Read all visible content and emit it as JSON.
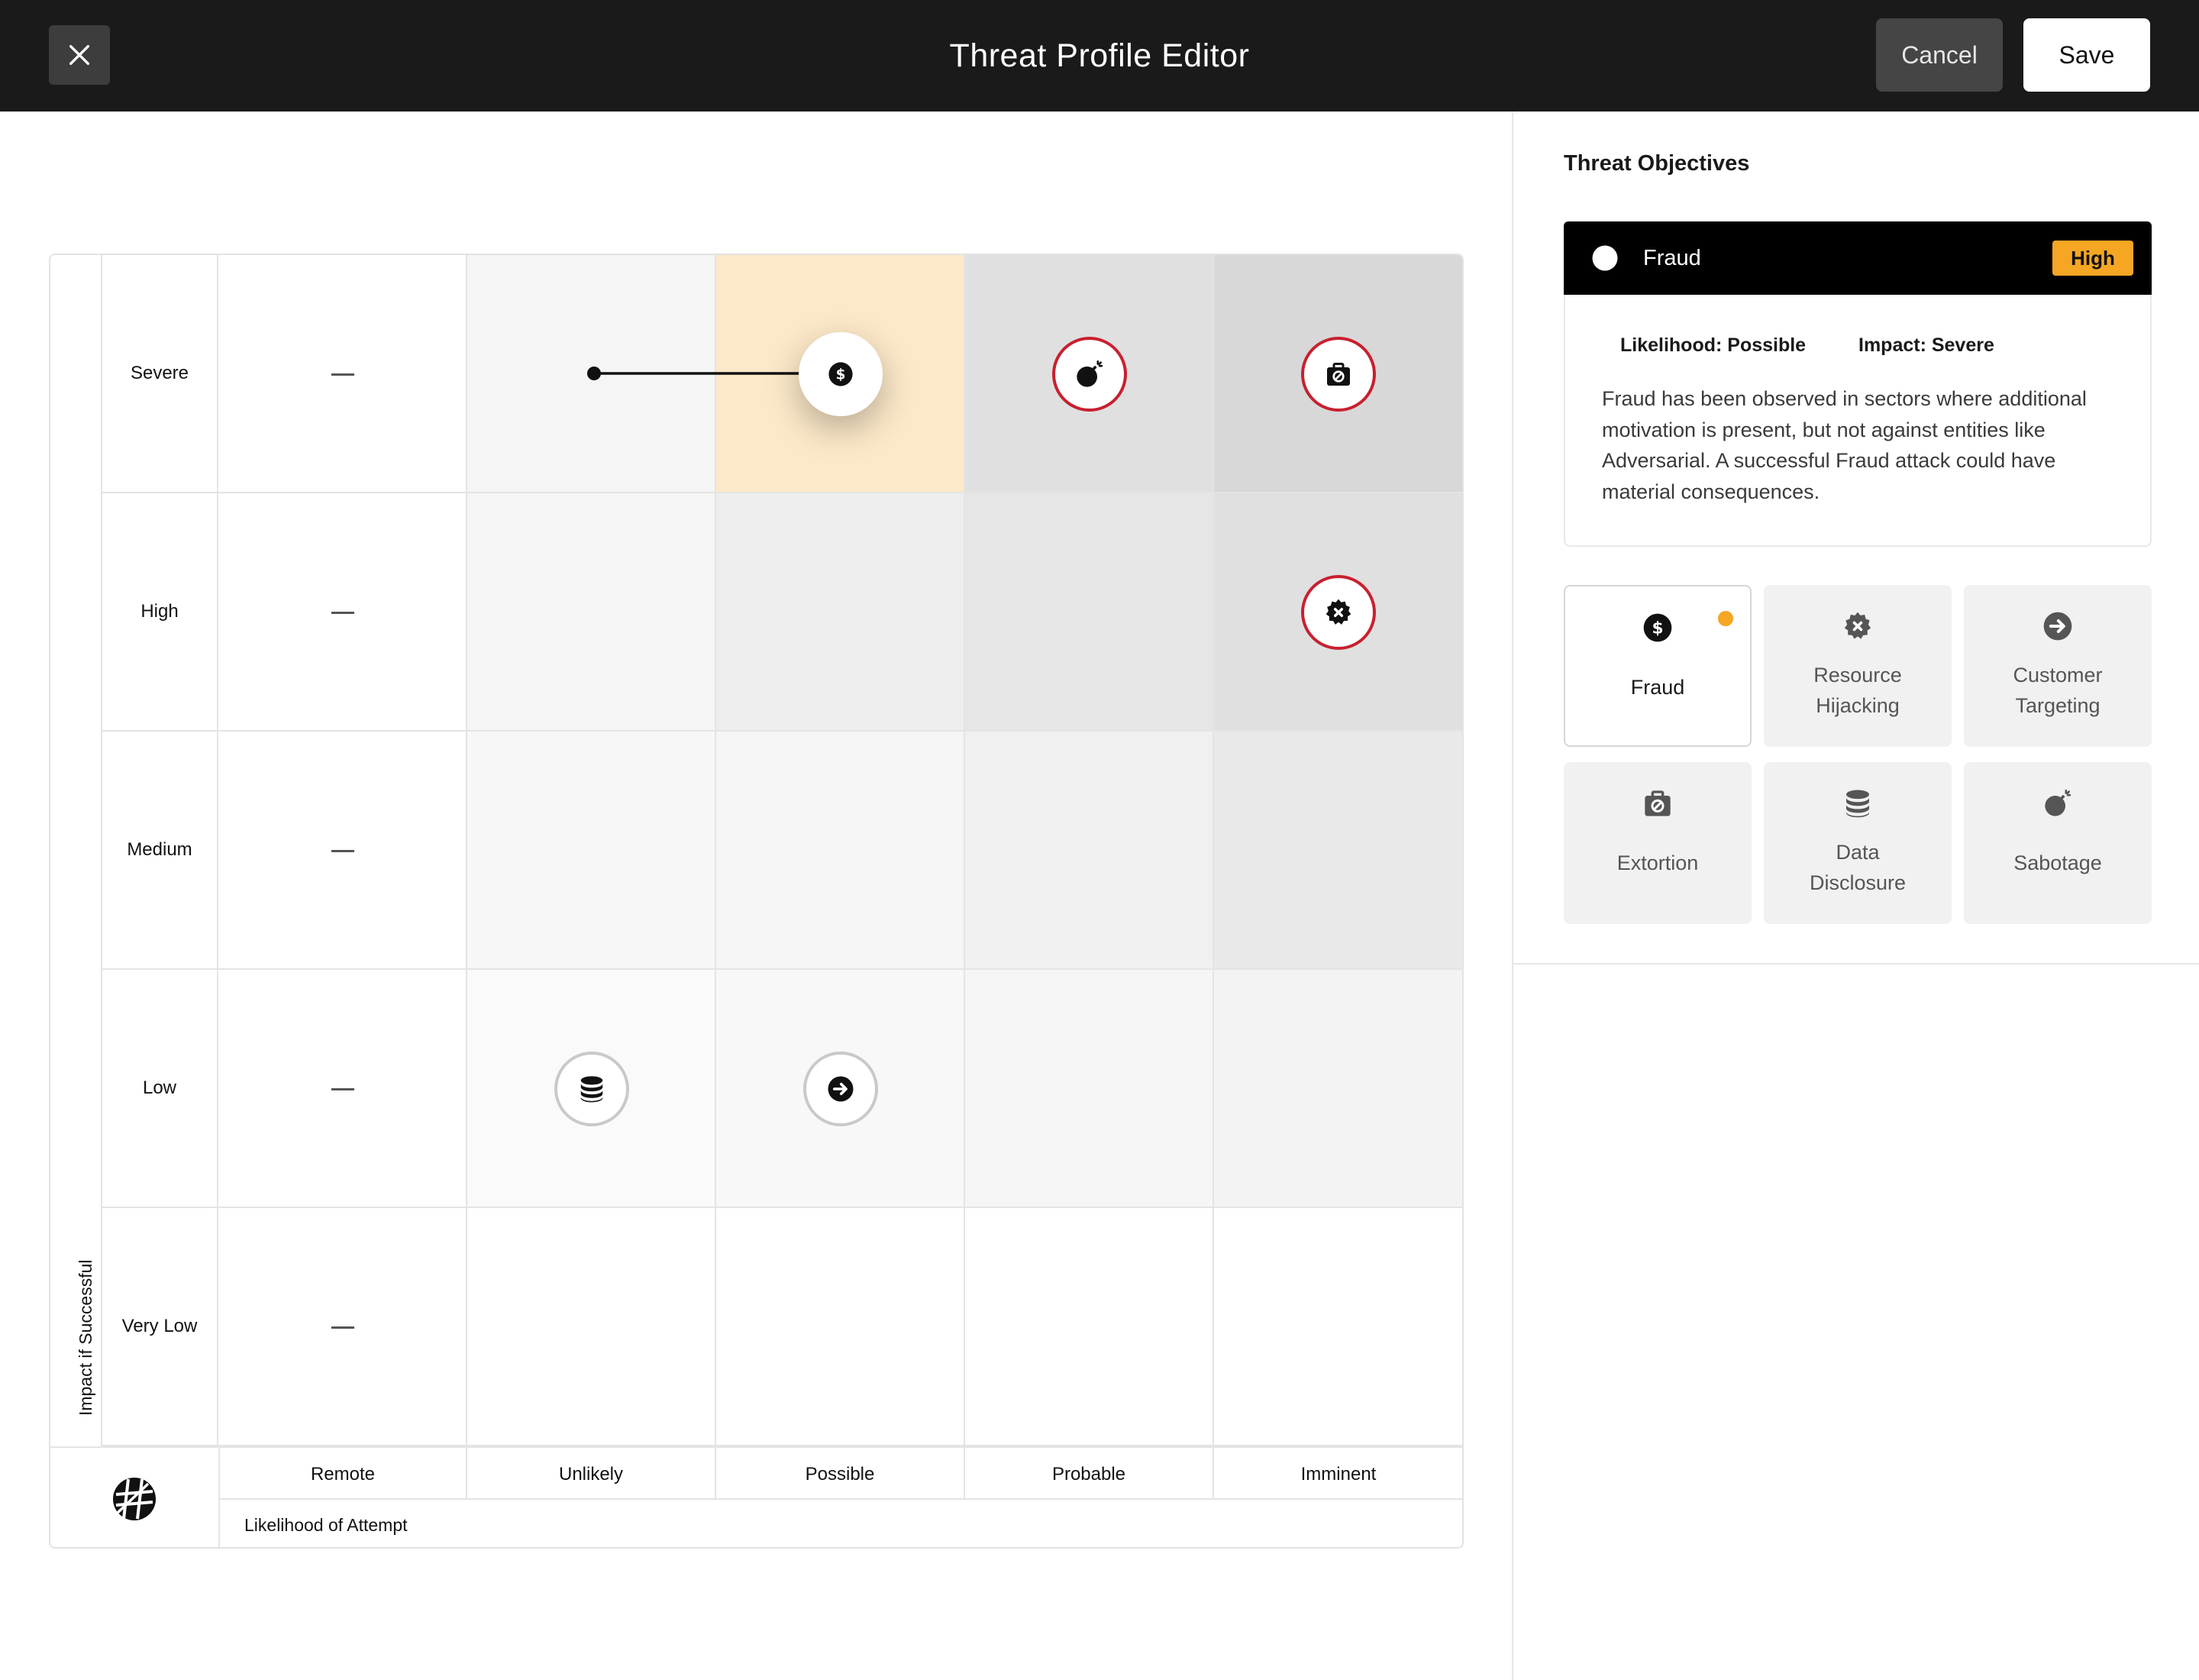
{
  "header": {
    "title": "Threat Profile Editor",
    "cancel_label": "Cancel",
    "save_label": "Save"
  },
  "matrix": {
    "y_axis_label": "Impact if Successful",
    "x_axis_label": "Likelihood of Attempt",
    "rows": [
      "Severe",
      "High",
      "Medium",
      "Low",
      "Very Low"
    ],
    "columns": [
      "Remote",
      "Unlikely",
      "Possible",
      "Probable",
      "Imminent"
    ],
    "remote_placeholder": "—",
    "colors": {
      "highlight_cell": "#fde9c9",
      "risk_border": "#c8202f",
      "neutral_border": "#c9c9c9"
    },
    "placements": [
      {
        "objective": "Fraud",
        "impact": "Severe",
        "likelihood": "Possible",
        "icon": "dollar-icon",
        "style": "selected",
        "moved_from": "Unlikely"
      },
      {
        "objective": "Sabotage",
        "impact": "Severe",
        "likelihood": "Probable",
        "icon": "bomb-icon",
        "style": "red"
      },
      {
        "objective": "Extortion",
        "impact": "Severe",
        "likelihood": "Imminent",
        "icon": "briefcase-icon",
        "style": "red"
      },
      {
        "objective": "Resource Hijacking",
        "impact": "High",
        "likelihood": "Imminent",
        "icon": "gear-x-icon",
        "style": "red"
      },
      {
        "objective": "Data Disclosure",
        "impact": "Low",
        "likelihood": "Unlikely",
        "icon": "database-icon",
        "style": "grey"
      },
      {
        "objective": "Customer Targeting",
        "impact": "Low",
        "likelihood": "Possible",
        "icon": "arrow-right-icon",
        "style": "grey"
      }
    ]
  },
  "panel": {
    "title": "Threat Objectives",
    "selected": {
      "name": "Fraud",
      "icon": "dollar-icon",
      "badge": "High",
      "badge_color": "#f5a623",
      "likelihood": "Likelihood: Possible",
      "impact": "Impact: Severe",
      "description": "Fraud has been observed in sectors where additional motivation is present, but not against entities like Adversarial. A successful Fraud attack could have material consequences."
    },
    "objectives": [
      {
        "label": "Fraud",
        "icon": "dollar-icon",
        "active": true
      },
      {
        "label": "Resource Hijacking",
        "icon": "gear-x-icon",
        "active": false
      },
      {
        "label": "Customer Targeting",
        "icon": "arrow-right-icon",
        "active": false
      },
      {
        "label": "Extortion",
        "icon": "briefcase-icon",
        "active": false
      },
      {
        "label": "Data Disclosure",
        "icon": "database-icon",
        "active": false
      },
      {
        "label": "Sabotage",
        "icon": "bomb-icon",
        "active": false
      }
    ]
  }
}
